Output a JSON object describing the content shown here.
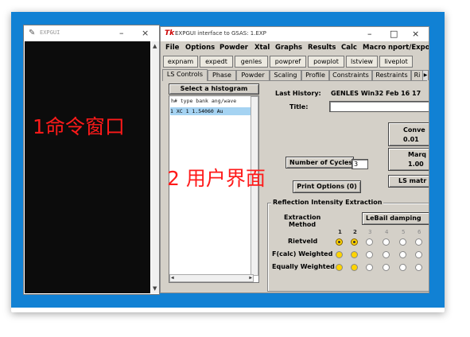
{
  "console": {
    "title": "EXPGUI",
    "icon": "tk-feather-icon",
    "annotation": "1命令窗口"
  },
  "main_window": {
    "title": "EXPGUI interface to GSAS: 1.EXP",
    "annotation": "2 用户界面",
    "menu": [
      "File",
      "Options",
      "Powder",
      "Xtal",
      "Graphs",
      "Results",
      "Calc",
      "Macro",
      "nport/Expo"
    ],
    "toolbar": [
      "expnam",
      "expedt",
      "genles",
      "powpref",
      "powplot",
      "lstview",
      "liveplot"
    ],
    "tabs": [
      "LS Controls",
      "Phase",
      "Powder",
      "Scaling",
      "Profile",
      "Constraints",
      "Restraints",
      "Ri"
    ],
    "active_tab": "LS Controls"
  },
  "ls_controls": {
    "select_histogram_label": "Select a histogram",
    "hist_header": "h# type bank ang/wave",
    "hist_rows": [
      "1  XC     1  1.54060  Au"
    ],
    "last_history_label": "Last History:",
    "last_history_value": "GENLES  Win32  Feb 16 17",
    "title_label": "Title:",
    "title_value": "",
    "cycles_label": "Number of Cycles",
    "cycles_value": "3",
    "print_options_label": "Print Options (0)",
    "convergence_label": "Conve",
    "convergence_value": "0.01",
    "marquardt_label": "Marq",
    "marquardt_value": "1.00",
    "ls_matrix_label": "LS matr"
  },
  "reflection": {
    "group_label": "Reflection Intensity Extraction",
    "method_label_line1": "Extraction",
    "method_label_line2": "Method",
    "method_value": "LeBail damping",
    "columns": [
      "1",
      "2",
      "3",
      "4",
      "5",
      "6"
    ],
    "rows": [
      {
        "label": "Rietveld",
        "selected": [
          true,
          true,
          false,
          false,
          false,
          false
        ]
      },
      {
        "label": "F(calc) Weighted",
        "selected": [
          false,
          false,
          false,
          false,
          false,
          false
        ]
      },
      {
        "label": "Equally Weighted",
        "selected": [
          false,
          false,
          false,
          false,
          false,
          false
        ]
      }
    ]
  }
}
